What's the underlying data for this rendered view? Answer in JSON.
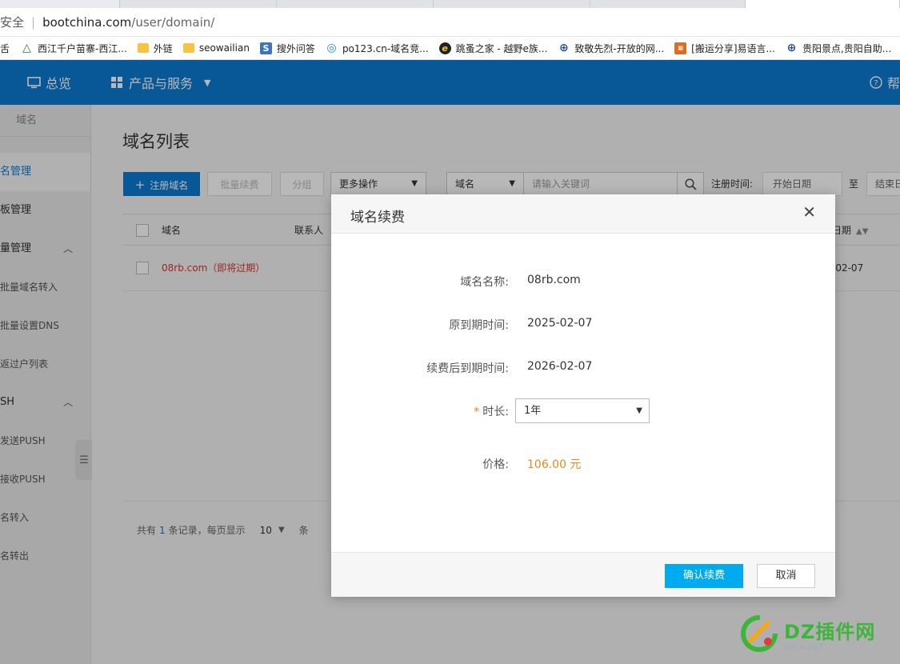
{
  "browser": {
    "secure_label": "安全",
    "url_host": "bootchina.com",
    "url_path": "/user/domain/"
  },
  "bookmarks": [
    {
      "icon": "tree-icon",
      "label": "西江千户苗寨-西江..."
    },
    {
      "icon": "folder-icon",
      "label": "外链"
    },
    {
      "icon": "folder-icon",
      "label": "seowailian"
    },
    {
      "icon": "s-icon",
      "label": "搜外问答"
    },
    {
      "icon": "swirl-icon",
      "label": "po123.cn-域名竞..."
    },
    {
      "icon": "e-icon",
      "label": "跳蚤之家 - 越野e族..."
    },
    {
      "icon": "globe-icon",
      "label": "致敬先烈-开放的网..."
    },
    {
      "icon": "badge-icon",
      "label": "[搬运分享]易语言..."
    },
    {
      "icon": "globe-icon",
      "label": "贵阳景点,贵阳自助..."
    }
  ],
  "bookmarks_prefix": "舌",
  "topnav": {
    "overview": "总览",
    "products": "产品与服务",
    "help": "帮"
  },
  "sidebar": {
    "title": "域名",
    "items": [
      {
        "label": "名管理"
      },
      {
        "label": "板管理"
      },
      {
        "label": "量管理"
      },
      {
        "label": "批量域名转入"
      },
      {
        "label": "批量设置DNS"
      },
      {
        "label": "返过户列表"
      },
      {
        "label": "SH"
      },
      {
        "label": "发送PUSH"
      },
      {
        "label": "接收PUSH"
      },
      {
        "label": "名转入"
      },
      {
        "label": "名转出"
      }
    ]
  },
  "main": {
    "title": "域名列表",
    "register_btn": "注册域名",
    "batch_renew_btn": "批量续费",
    "group_btn": "分组",
    "more_ops": "更多操作",
    "search_field": "域名",
    "search_placeholder": "请输入关键词",
    "reg_time_label": "注册时间:",
    "start_date": "开始日期",
    "to_label": "至",
    "end_date": "结束日",
    "columns": {
      "domain": "域名",
      "contact": "联系人",
      "expire": "日期"
    },
    "rows": [
      {
        "domain": "08rb.com",
        "tag": "（即将过期）",
        "expire": "-02-07"
      }
    ],
    "pager": {
      "prefix": "共有",
      "count": "1",
      "suffix": "条记录，每页显示",
      "page_size": "10",
      "unit": "条"
    }
  },
  "modal": {
    "title": "域名续费",
    "fields": {
      "domain_label": "域名名称:",
      "domain_value": "08rb.com",
      "orig_label": "原到期时间:",
      "orig_value": "2025-02-07",
      "new_label": "续费后到期时间:",
      "new_value": "2026-02-07",
      "duration_label": "时长:",
      "duration_value": "1年",
      "price_label": "价格:",
      "price_value": "106.00 元"
    },
    "confirm": "确认续费",
    "cancel": "取消"
  },
  "watermark": {
    "main": "DZ插件网",
    "sub": "DZ-X.NET"
  },
  "colors": {
    "nav_blue": "#0c7bd1",
    "confirm_blue": "#00aaee",
    "expire_red": "#d9372b",
    "price_orange": "#e08a1d"
  }
}
